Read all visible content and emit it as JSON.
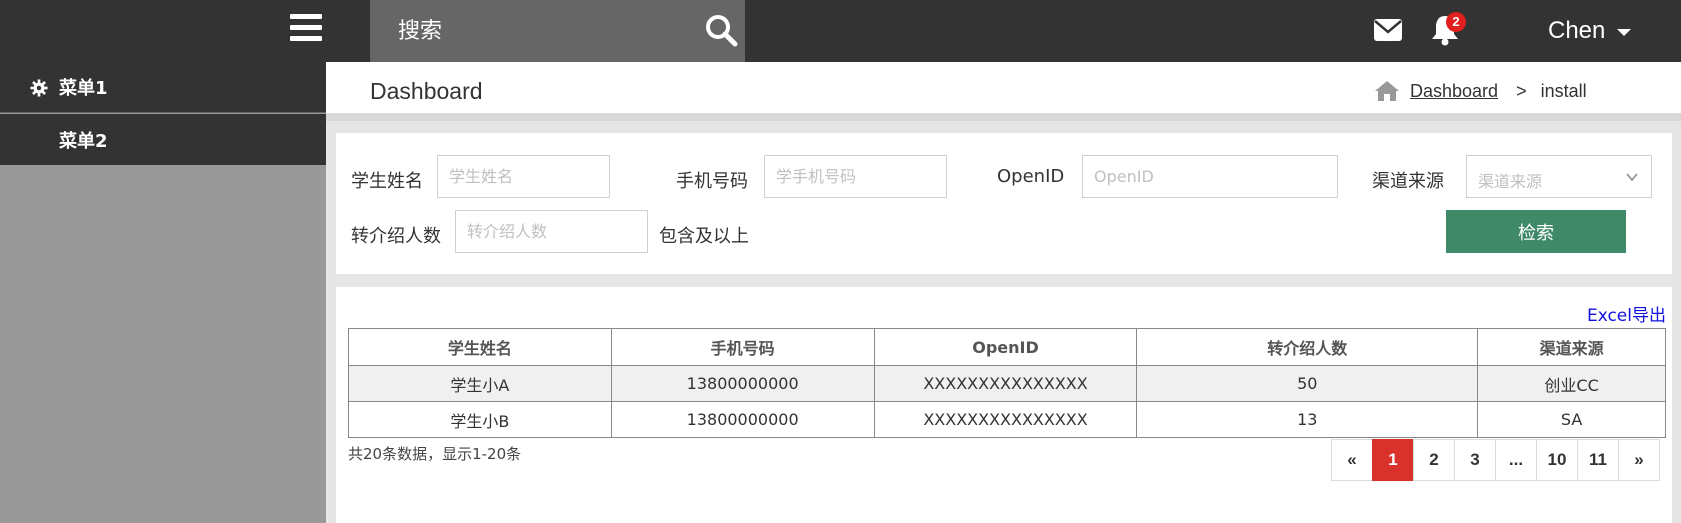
{
  "topbar": {
    "search_placeholder": "搜索",
    "notification_count": "2",
    "user_name": "Chen"
  },
  "sidebar": {
    "items": [
      {
        "label": "菜单1",
        "icon": "gear-icon"
      },
      {
        "label": "菜单2"
      }
    ]
  },
  "header": {
    "title": "Dashboard",
    "breadcrumb": {
      "home": "Dashboard",
      "separator": ">",
      "current": "install"
    }
  },
  "filters": {
    "student_name": {
      "label": "学生姓名",
      "placeholder": "学生姓名"
    },
    "phone": {
      "label": "手机号码",
      "placeholder": "学手机号码"
    },
    "openid": {
      "label": "OpenID",
      "placeholder": "OpenID"
    },
    "channel": {
      "label": "渠道来源",
      "placeholder": "渠道来源"
    },
    "referrals": {
      "label": "转介绍人数",
      "placeholder": "转介绍人数",
      "suffix": "包含及以上"
    },
    "search_button": "检索"
  },
  "table": {
    "export_label": "Excel导出",
    "columns": [
      "学生姓名",
      "手机号码",
      "OpenID",
      "转介绍人数",
      "渠道来源"
    ],
    "rows": [
      [
        "学生小A",
        "13800000000",
        "XXXXXXXXXXXXXXX",
        "50",
        "创业CC"
      ],
      [
        "学生小B",
        "13800000000",
        "XXXXXXXXXXXXXXX",
        "13",
        "SA"
      ]
    ],
    "summary": "共20条数据，显示1-20条"
  },
  "pagination": {
    "prev": "«",
    "pages": [
      "1",
      "2",
      "3",
      "...",
      "10",
      "11"
    ],
    "next": "»",
    "current": "1"
  },
  "colors": {
    "topbar": "#333333",
    "search_bg": "#666666",
    "sidebar_bg": "#999999",
    "primary_button": "#3f8868",
    "active_page": "#d9312c",
    "badge": "#e0201e",
    "link": "#1010e0"
  }
}
